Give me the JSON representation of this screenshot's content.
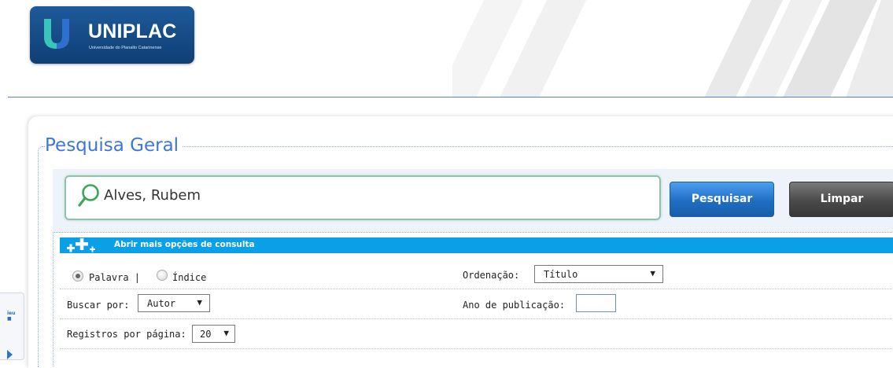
{
  "logo": {
    "name": "UNIPLAC",
    "tagline": "Universidade do Planalto Catarinense",
    "icon": "uniplac-u-logo"
  },
  "page": {
    "title": "Pesquisa Geral"
  },
  "search": {
    "value": "Alves, Rubem",
    "icon": "search-icon"
  },
  "buttons": {
    "search_label": "Pesquisar",
    "clear_label": "Limpar"
  },
  "options": {
    "toggle_label": "Abrir mais opções de consulta",
    "mode": {
      "word_label": "Palavra |",
      "index_label": "Índice",
      "selected": "Palavra"
    },
    "order": {
      "label": "Ordenação:",
      "value": "Título"
    },
    "search_by": {
      "label": "Buscar por:",
      "value": "Autor"
    },
    "year": {
      "label": "Ano de publicação:",
      "value": ""
    },
    "per_page": {
      "label": "Registros por página:",
      "value": "20"
    }
  },
  "colors": {
    "accent": "#3d76d8",
    "options_bar": "#0aa0e8",
    "search_button": "#1f6ec4",
    "clear_button": "#4a4a4a"
  }
}
